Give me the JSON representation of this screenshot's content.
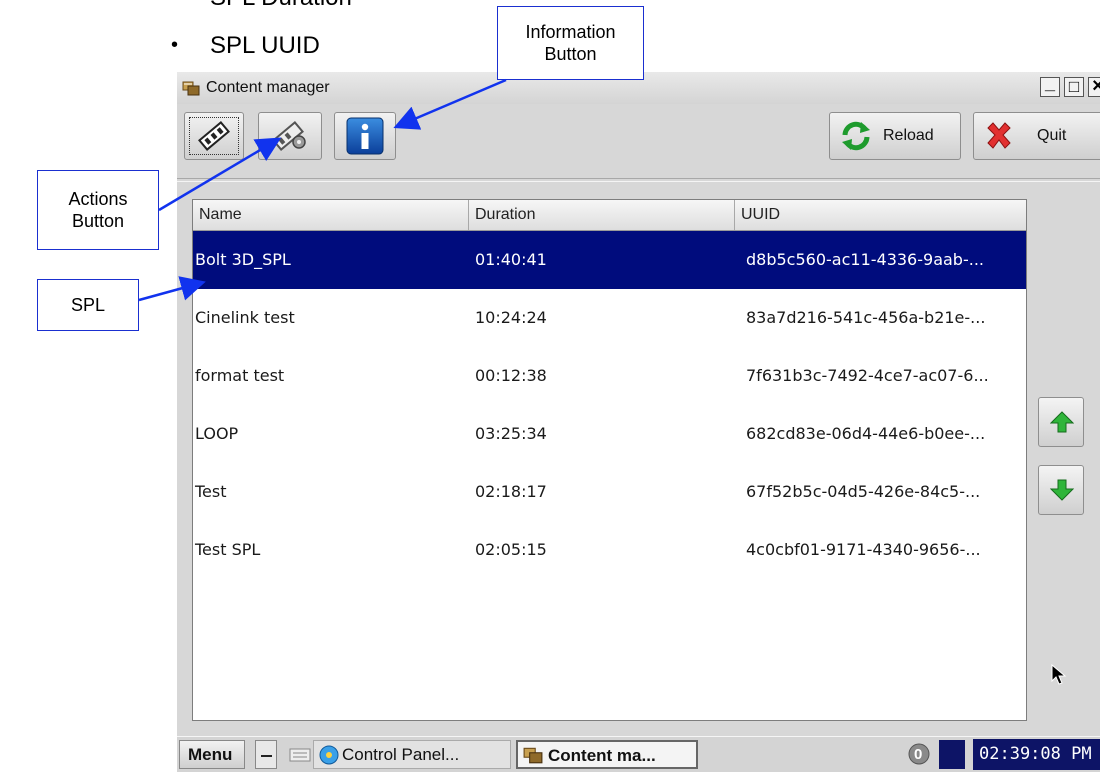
{
  "doc": {
    "partial_bullet": "SPL Duration",
    "bullet_symbol": "•",
    "bullet_text": "SPL UUID"
  },
  "callouts": {
    "information": "Information Button",
    "actions": "Actions Button",
    "spl": "SPL"
  },
  "window": {
    "title": "Content manager",
    "controls": [
      "_",
      "□",
      "×"
    ]
  },
  "toolbar": {
    "reload_label": "Reload",
    "quit_label": "Quit"
  },
  "table": {
    "columns": [
      "Name",
      "Duration",
      "UUID"
    ],
    "rows": [
      {
        "name": "Bolt 3D_SPL",
        "duration": "01:40:41",
        "uuid": "d8b5c560-ac11-4336-9aab-...",
        "selected": true
      },
      {
        "name": "Cinelink test",
        "duration": "10:24:24",
        "uuid": "83a7d216-541c-456a-b21e-..."
      },
      {
        "name": "format test",
        "duration": "00:12:38",
        "uuid": "7f631b3c-7492-4ce7-ac07-6..."
      },
      {
        "name": "LOOP",
        "duration": "03:25:34",
        "uuid": "682cd83e-06d4-44e6-b0ee-..."
      },
      {
        "name": "Test",
        "duration": "02:18:17",
        "uuid": "67f52b5c-04d5-426e-84c5-..."
      },
      {
        "name": "Test SPL",
        "duration": "02:05:15",
        "uuid": "4c0cbf01-9171-4340-9656-..."
      }
    ]
  },
  "taskbar": {
    "menu_label": "Menu",
    "tasks": [
      "Control Panel...",
      "Content ma..."
    ],
    "notification_count": "0",
    "clock": "02:39:08 PM"
  },
  "colors": {
    "selection": "#000c7d",
    "callout_border": "#1a2fd0",
    "arrow": "#1133ee"
  }
}
